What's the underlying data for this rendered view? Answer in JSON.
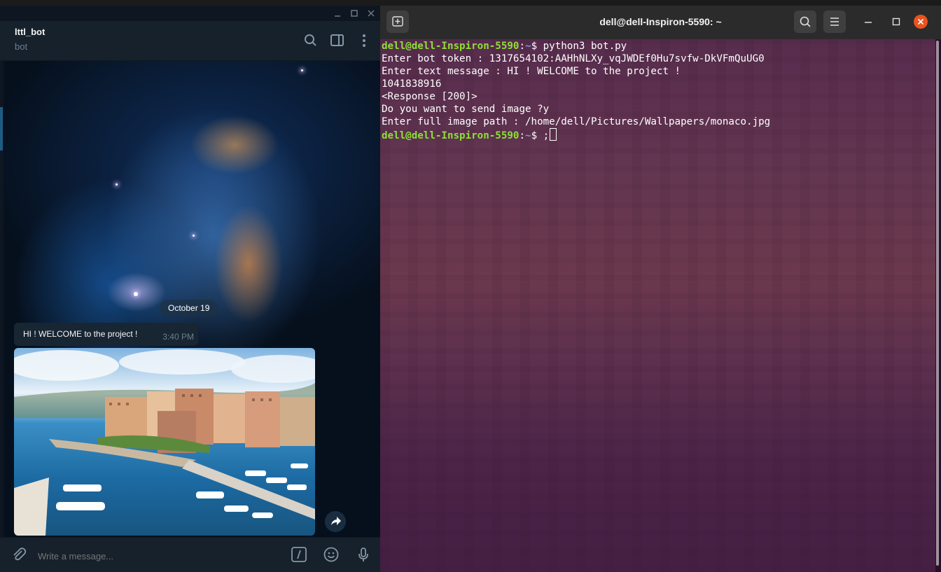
{
  "telegram": {
    "chat_name": "lttl_bot",
    "chat_status": "bot",
    "date_label": "October 19",
    "message": {
      "text": "HI ! WELCOME to the project !",
      "time": "3:40 PM"
    },
    "input_placeholder": "Write a message...",
    "icons": [
      "minimize-icon",
      "maximize-icon",
      "close-icon",
      "search-icon",
      "sidebar-toggle-icon",
      "more-vert-icon",
      "share-icon",
      "attach-icon",
      "bot-command-icon",
      "emoji-icon",
      "microphone-icon"
    ],
    "colors": {
      "panel": "#17212b",
      "bubble": "#182533",
      "muted": "#6d7f8f"
    }
  },
  "terminal": {
    "title": "dell@dell-Inspiron-5590: ~",
    "prompt_user": "dell@dell-Inspiron-5590",
    "prompt_path": "~",
    "lines": {
      "l1_cmd": "$ python3 bot.py",
      "l2": "Enter bot token : 1317654102:AAHhNLXy_vqJWDEf0Hu7svfw-DkVFmQuUG0",
      "l3": "Enter text message : HI ! WELCOME to the project !",
      "l4": "1041838916",
      "l5": "<Response [200]>",
      "l6": "Do you want to send image ?y",
      "l7": "Enter full image path : /home/dell/Pictures/Wallpapers/monaco.jpg",
      "l8_cmd": "$ ;"
    },
    "colors": {
      "prompt_user": "#8ae234",
      "prompt_path": "#729fcf",
      "close_button": "#e95420"
    }
  }
}
